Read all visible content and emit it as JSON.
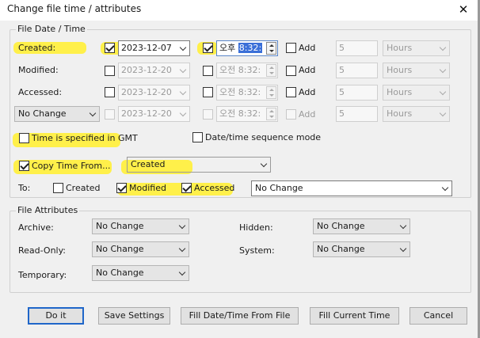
{
  "window": {
    "title": "Change file time / attributes",
    "close_glyph": "✕"
  },
  "date_group": {
    "legend": "File Date / Time",
    "rows": [
      {
        "label": "Created:",
        "date": "2023-12-07",
        "ampm": "오후",
        "time": "8:32:",
        "add_label": "Add",
        "add_value": "5",
        "unit": "Hours"
      },
      {
        "label": "Modified:",
        "date": "2023-12-20",
        "ampm": "오전",
        "time": "8:32:",
        "add_label": "Add",
        "add_value": "5",
        "unit": "Hours"
      },
      {
        "label": "Accessed:",
        "date": "2023-12-20",
        "ampm": "오전",
        "time": "8:32:",
        "add_label": "Add",
        "add_value": "5",
        "unit": "Hours"
      },
      {
        "label": "No Change",
        "date": "2023-12-20",
        "ampm": "오전",
        "time": "8:32:",
        "add_label": "Add",
        "add_value": "5",
        "unit": "Hours"
      }
    ],
    "gmt_label": "Time is specified in GMT",
    "sequence_label": "Date/time sequence mode",
    "copy_label": "Copy Time From...",
    "copy_source": "Created",
    "to_label": "To:",
    "to_created": "Created",
    "to_modified": "Modified",
    "to_accessed": "Accessed",
    "to_extra": "No Change"
  },
  "attr_group": {
    "legend": "File Attributes",
    "archive_label": "Archive:",
    "archive_value": "No Change",
    "readonly_label": "Read-Only:",
    "readonly_value": "No Change",
    "temporary_label": "Temporary:",
    "temporary_value": "No Change",
    "hidden_label": "Hidden:",
    "hidden_value": "No Change",
    "system_label": "System:",
    "system_value": "No Change"
  },
  "buttons": {
    "do_it": "Do it",
    "save_settings": "Save Settings",
    "fill_from_file": "Fill Date/Time From File",
    "fill_current": "Fill Current Time",
    "cancel": "Cancel"
  },
  "colors": {
    "highlight": "#fff04a",
    "time_selection": "#3a6fd8",
    "default_button_border": "#1f66c9"
  }
}
